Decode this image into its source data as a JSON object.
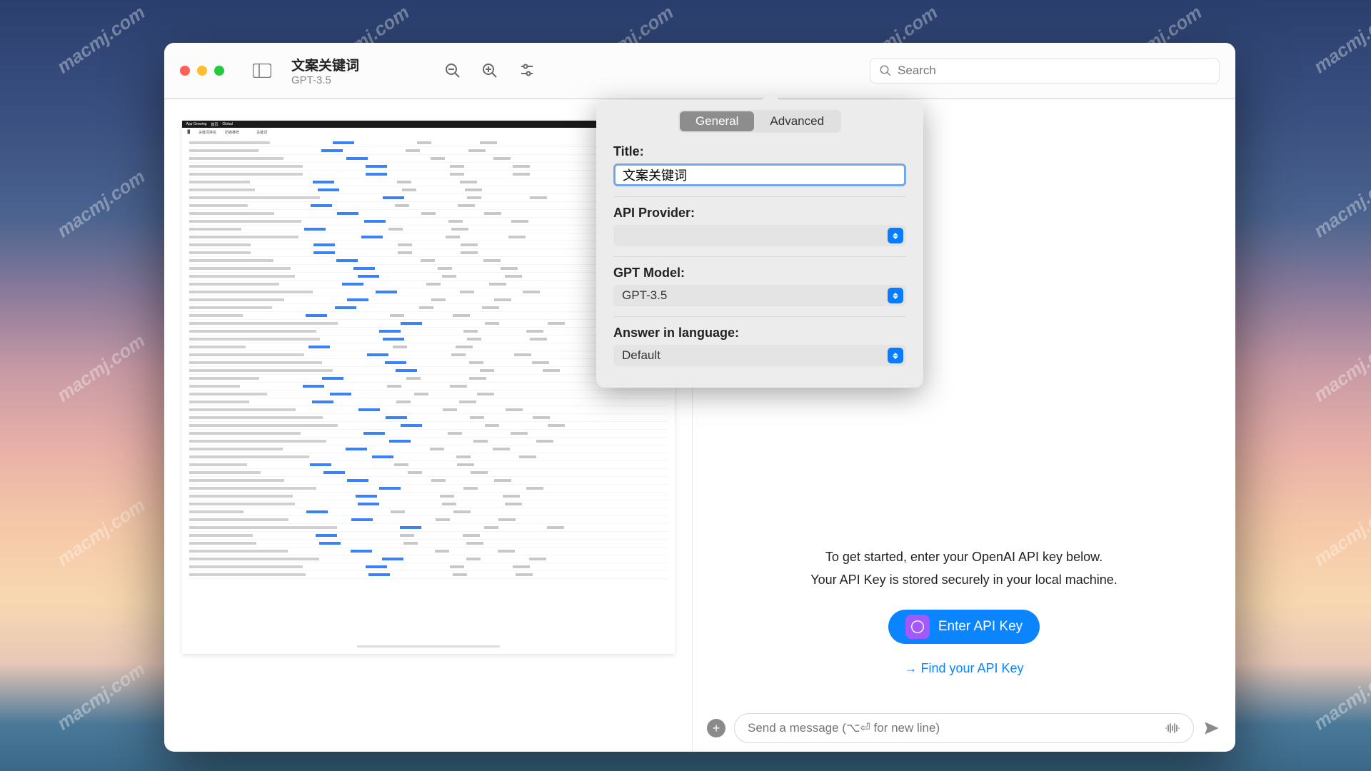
{
  "watermark_text": "macmj.com",
  "titlebar": {
    "title": "文案关键词",
    "subtitle": "GPT-3.5"
  },
  "search": {
    "placeholder": "Search"
  },
  "popover": {
    "tabs": {
      "general": "General",
      "advanced": "Advanced"
    },
    "title_label": "Title:",
    "title_value": "文案关键词",
    "api_provider_label": "API Provider:",
    "api_provider_value": "",
    "gpt_model_label": "GPT Model:",
    "gpt_model_value": "GPT-3.5",
    "language_label": "Answer in language:",
    "language_value": "Default"
  },
  "right": {
    "help_line1": "To get started, enter your OpenAI API key below.",
    "help_line2": "Your API Key is stored securely in your local machine.",
    "enter_key": "Enter API Key",
    "find_key": "→ Find your API Key"
  },
  "composer": {
    "placeholder": "Send a message (⌥⏎ for new line)"
  }
}
